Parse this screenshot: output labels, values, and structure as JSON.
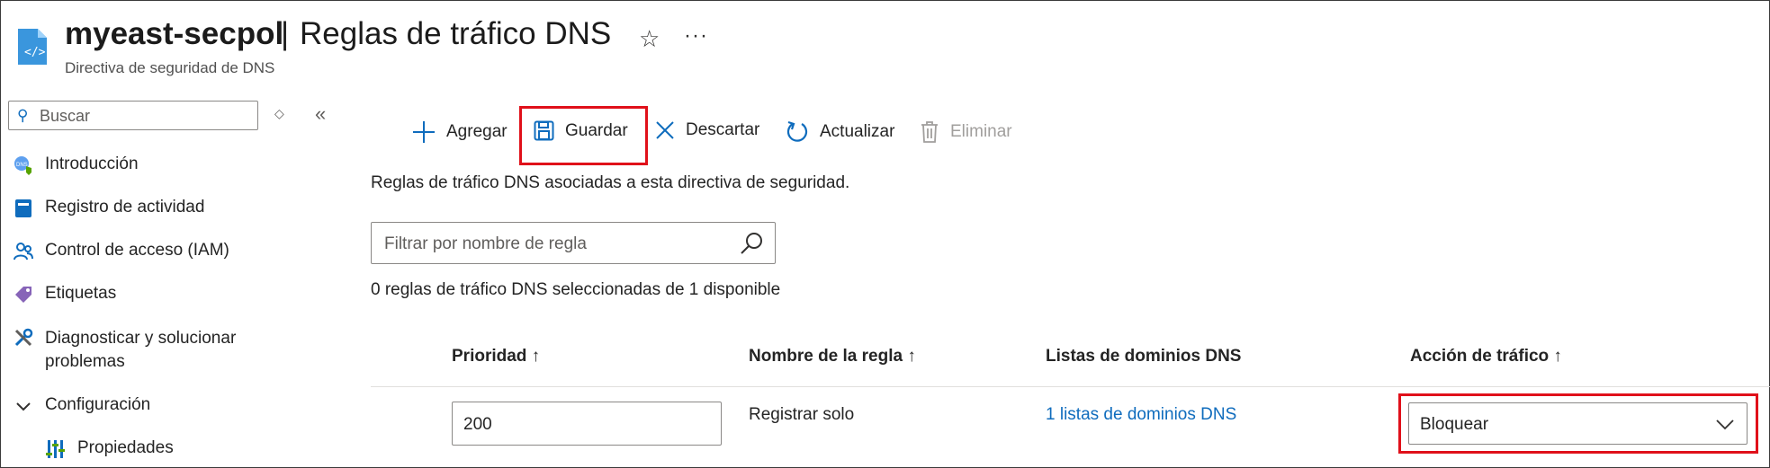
{
  "header": {
    "resource_name": "myeast-secpol",
    "separator": "|",
    "page_title": "Reglas de tráfico DNS",
    "subtitle": "Directiva de seguridad de DNS",
    "favorite_icon": "star-icon",
    "more_icon": "ellipsis-icon"
  },
  "sidebar": {
    "search_placeholder": "Buscar",
    "items": [
      {
        "label": "Introducción",
        "icon": "dns-overview-icon"
      },
      {
        "label": "Registro de actividad",
        "icon": "activity-log-icon"
      },
      {
        "label": "Control de acceso (IAM)",
        "icon": "people-icon"
      },
      {
        "label": "Etiquetas",
        "icon": "tag-icon"
      },
      {
        "label": "Diagnosticar y solucionar problemas",
        "icon": "wrench-icon"
      },
      {
        "label": "Configuración",
        "icon": "chevron-down-icon"
      },
      {
        "label": "Propiedades",
        "icon": "properties-icon"
      }
    ]
  },
  "toolbar": {
    "add_label": "Agregar",
    "save_label": "Guardar",
    "discard_label": "Descartar",
    "refresh_label": "Actualizar",
    "delete_label": "Eliminar"
  },
  "content": {
    "description": "Reglas de tráfico DNS asociadas a esta directiva de seguridad.",
    "filter_placeholder": "Filtrar por nombre de regla",
    "selection_count": "0 reglas de tráfico DNS seleccionadas de 1 disponible"
  },
  "table": {
    "columns": [
      "Prioridad ↑",
      "Nombre de la regla ↑",
      "Listas de dominios DNS",
      "Acción de tráfico ↑"
    ],
    "rows": [
      {
        "priority": "200",
        "rule_name": "Registrar solo",
        "domain_lists": "1 listas de dominios DNS",
        "action": "Bloquear"
      }
    ]
  },
  "colors": {
    "accent": "#0f6cbd",
    "highlight": "#e0101a",
    "disabled": "#a19f9d"
  }
}
